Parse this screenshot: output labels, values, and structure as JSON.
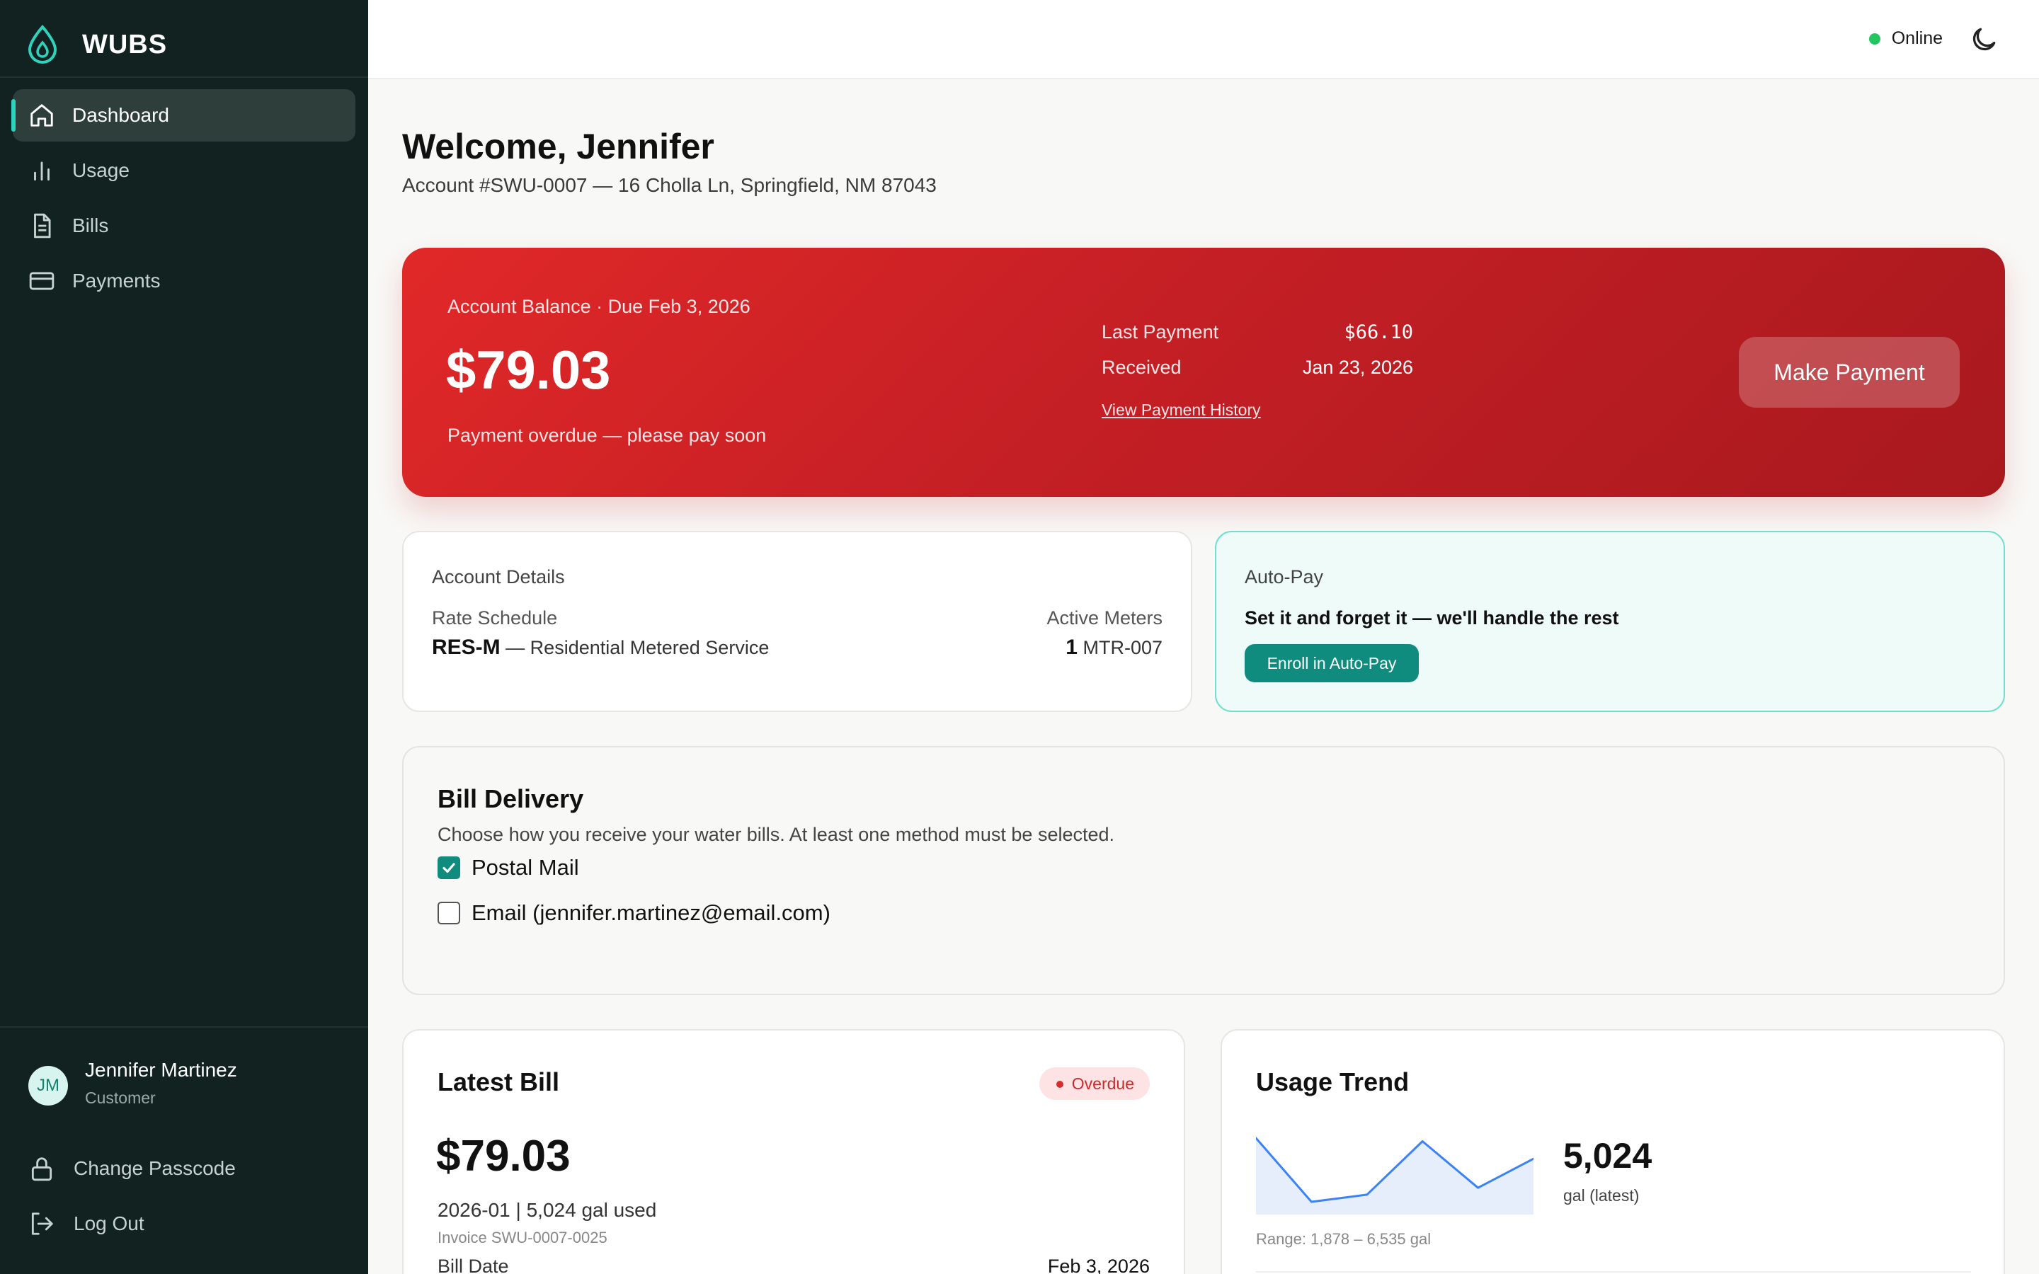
{
  "brand": {
    "name": "WUBS"
  },
  "nav": [
    {
      "label": "Dashboard",
      "icon": "home-icon",
      "active": true
    },
    {
      "label": "Usage",
      "icon": "bar-chart-icon",
      "active": false
    },
    {
      "label": "Bills",
      "icon": "document-icon",
      "active": false
    },
    {
      "label": "Payments",
      "icon": "credit-card-icon",
      "active": false
    }
  ],
  "user": {
    "initials": "JM",
    "name": "Jennifer Martinez",
    "role": "Customer"
  },
  "side_actions": [
    {
      "label": "Change Passcode",
      "icon": "lock-icon"
    },
    {
      "label": "Log Out",
      "icon": "logout-icon"
    }
  ],
  "topbar": {
    "status": "Online",
    "status_color": "#22c55e",
    "theme_icon": "moon-icon"
  },
  "header": {
    "welcome": "Welcome, Jennifer",
    "account_line": "Account #SWU-0007 — 16 Cholla Ln, Springfield, NM 87043"
  },
  "balance": {
    "label": "Account Balance · Due Feb 3, 2026",
    "amount": "$79.03",
    "note": "Payment overdue — please pay soon",
    "last_payment_label": "Last Payment",
    "last_payment_value": "$66.10",
    "received_label": "Received",
    "received_value": "Jan 23, 2026",
    "history_link": "View Payment History",
    "pay_button": "Make Payment",
    "accent": "#d42326"
  },
  "account_details": {
    "title": "Account Details",
    "rate_label": "Rate Schedule",
    "rate_code": "RES-M",
    "rate_desc": " — Residential Metered Service",
    "meters_label": "Active Meters",
    "meters_count": "1",
    "meters_id": " MTR-007"
  },
  "autopay": {
    "title": "Auto-Pay",
    "subtitle": "Set it and forget it — we'll handle the rest",
    "button": "Enroll in Auto-Pay",
    "accent": "#0f8c7e"
  },
  "delivery": {
    "title": "Bill Delivery",
    "description": "Choose how you receive your water bills. At least one method must be selected.",
    "options": [
      {
        "label": "Postal Mail",
        "checked": true
      },
      {
        "label": "Email (jennifer.martinez@email.com)",
        "checked": false
      }
    ]
  },
  "latest_bill": {
    "title": "Latest Bill",
    "status": "Overdue",
    "amount": "$79.03",
    "meta": "2026-01 | 5,024 gal used",
    "invoice": "Invoice SWU-0007-0025",
    "date_label": "Bill Date",
    "date_value": "Feb 3, 2026"
  },
  "usage_trend": {
    "title": "Usage Trend",
    "latest": "5,024",
    "unit": "gal (latest)",
    "range": "Range: 1,878 – 6,535 gal"
  },
  "chart_data": {
    "type": "area",
    "series": [
      {
        "values": [
          6535,
          1878,
          2400,
          6300,
          2900,
          5024
        ]
      }
    ],
    "ylim": [
      1878,
      6535
    ],
    "grid": false,
    "line_color": "#3b82f6",
    "fill_color": "#e6eefc"
  }
}
